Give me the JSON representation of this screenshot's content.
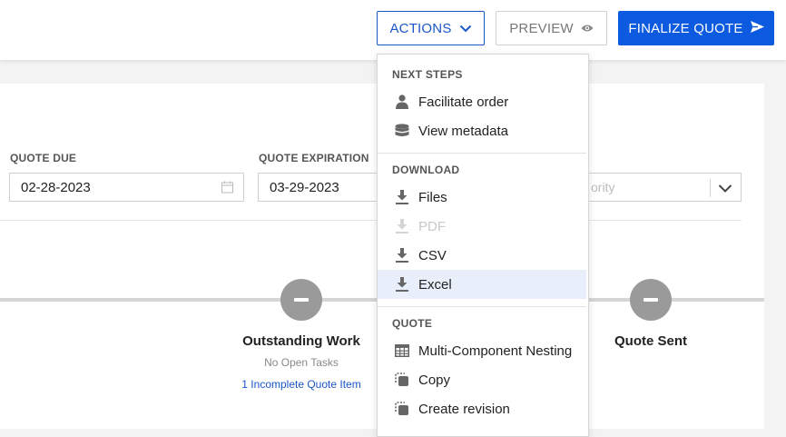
{
  "toolbar": {
    "actions_label": "ACTIONS",
    "preview_label": "PREVIEW",
    "finalize_label": "FINALIZE QUOTE"
  },
  "form": {
    "quote_due_label": "QUOTE DUE",
    "quote_due_value": "02-28-2023",
    "quote_expiration_label": "QUOTE EXPIRATION",
    "quote_expiration_value": "03-29-2023",
    "priority_placeholder": "ority"
  },
  "progress": {
    "steps": [
      {
        "title": "Outstanding Work",
        "subtitle": "No Open Tasks",
        "link": "1 Incomplete Quote Item"
      },
      {
        "title": "Quote Sent"
      }
    ]
  },
  "menu": {
    "sections": [
      {
        "label": "NEXT STEPS",
        "items": [
          {
            "label": "Facilitate order",
            "icon": "person-icon"
          },
          {
            "label": "View metadata",
            "icon": "database-icon"
          }
        ]
      },
      {
        "label": "DOWNLOAD",
        "items": [
          {
            "label": "Files",
            "icon": "download-icon"
          },
          {
            "label": "PDF",
            "icon": "download-icon",
            "disabled": true
          },
          {
            "label": "CSV",
            "icon": "download-icon"
          },
          {
            "label": "Excel",
            "icon": "download-icon",
            "highlighted": true
          }
        ]
      },
      {
        "label": "QUOTE",
        "items": [
          {
            "label": "Multi-Component Nesting",
            "icon": "table-icon"
          },
          {
            "label": "Copy",
            "icon": "copy-icon"
          },
          {
            "label": "Create revision",
            "icon": "revision-icon"
          }
        ]
      }
    ]
  },
  "colors": {
    "primary": "#0b5ae0",
    "outline_blue": "#1a56c8",
    "highlight": "#e8effa",
    "step_grey": "#9a9a9a"
  }
}
